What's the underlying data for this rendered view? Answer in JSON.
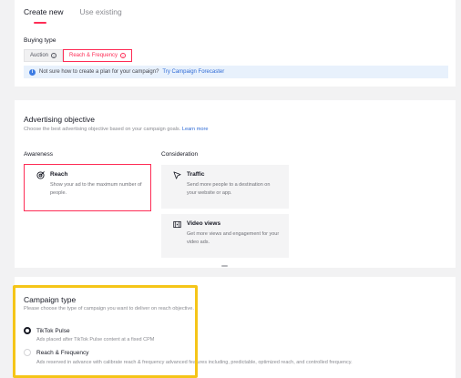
{
  "tabs": {
    "create_new": "Create new",
    "use_existing": "Use existing"
  },
  "buying_type": {
    "label": "Buying type",
    "options": {
      "auction": "Auction",
      "reach_frequency": "Reach & Frequency"
    },
    "info_glyph": "i"
  },
  "banner": {
    "text": "Not sure how to create a plan for your campaign?",
    "link": "Try Campaign Forecaster",
    "icon": "info-icon"
  },
  "advertising_objective": {
    "title": "Advertising objective",
    "subtitle": "Choose the best advertising objective based on your campaign goals.",
    "learn_more": "Learn more",
    "awareness_heading": "Awareness",
    "consideration_heading": "Consideration",
    "objectives": {
      "reach": {
        "name": "Reach",
        "desc": "Show your ad to the maximum number of people.",
        "icon": "reach-target-icon"
      },
      "traffic": {
        "name": "Traffic",
        "desc": "Send more people to a destination on your website or app.",
        "icon": "cursor-arrow-icon"
      },
      "video_views": {
        "name": "Video views",
        "desc": "Get more views and engagement for your video ads.",
        "icon": "video-film-icon"
      }
    }
  },
  "campaign_type": {
    "title": "Campaign type",
    "subtitle": "Please choose the type of campaign you want to deliver on reach objective.",
    "options": {
      "tiktok_pulse": {
        "label": "TikTok Pulse",
        "desc": "Ads placed after TikTok Pulse content at a fixed CPM",
        "checked": true
      },
      "reach_frequency": {
        "label": "Reach & Frequency",
        "desc": "Ads reserved in advance with calibrate reach & frequency advanced features including, predictable, optimized reach, and controlled frequency.",
        "checked": false
      }
    }
  },
  "colors": {
    "accent": "#fe2c55",
    "link": "#2f6bd6",
    "highlight": "#f5c518",
    "banner_bg": "#e8f1fc"
  }
}
